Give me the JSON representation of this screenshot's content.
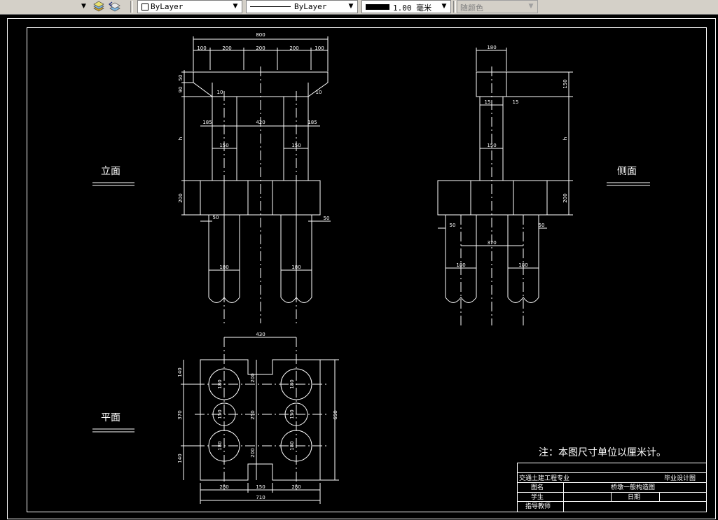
{
  "toolbar": {
    "layer_combo_value": "ByLayer",
    "linetype_combo_value": "ByLayer",
    "lineweight_combo_value": "1.00 毫米",
    "plotstyle_combo_value": "随颜色"
  },
  "views": {
    "elevation_label": "立面",
    "side_label": "侧面",
    "plan_label": "平面"
  },
  "note": "注：本图尺寸单位以厘米计。",
  "title_block": {
    "specialty": "交通土建工程专业",
    "doc_type": "毕业设计图",
    "drawing_name_label": "图名",
    "drawing_name_value": "桥墩一般构造图",
    "student_label": "学生",
    "date_label": "日期",
    "advisor_label": "指导教师"
  },
  "dims": {
    "e_total": "800",
    "e_s1": "100",
    "e_s2": "200",
    "e_s3": "200",
    "e_s4": "200",
    "e_s5": "100",
    "e_cap1": "50",
    "e_cap2": "90",
    "e_ch_l": "10",
    "e_ch_r": "10",
    "e_c1": "185",
    "e_c2": "420",
    "e_c3": "185",
    "e_h": "h",
    "e_col_l": "150",
    "e_col_r": "150",
    "e_foot_h": "200",
    "e_off_l": "50",
    "e_off_r": "50",
    "e_pile_l": "180",
    "e_pile_r": "180",
    "s_top": "180",
    "s_cap_h": "150",
    "s_15a": "15",
    "s_15b": "15",
    "s_h": "h",
    "s_col": "150",
    "s_foot_h": "200",
    "s_off_l": "50",
    "s_off_r": "50",
    "s_mid": "370",
    "s_pile_l": "180",
    "s_pile_r": "180",
    "p_top": "430",
    "p_140a": "140",
    "p_370": "370",
    "p_140b": "140",
    "p_650": "650",
    "p_200a": "200",
    "p_250": "250",
    "p_200b": "200",
    "p_d1": "180",
    "p_d2": "180",
    "p_d3": "150",
    "p_d4": "150",
    "p_d5": "180",
    "p_d6": "180",
    "p_b1": "280",
    "p_b2": "150",
    "p_b3": "280",
    "p_total": "710"
  }
}
